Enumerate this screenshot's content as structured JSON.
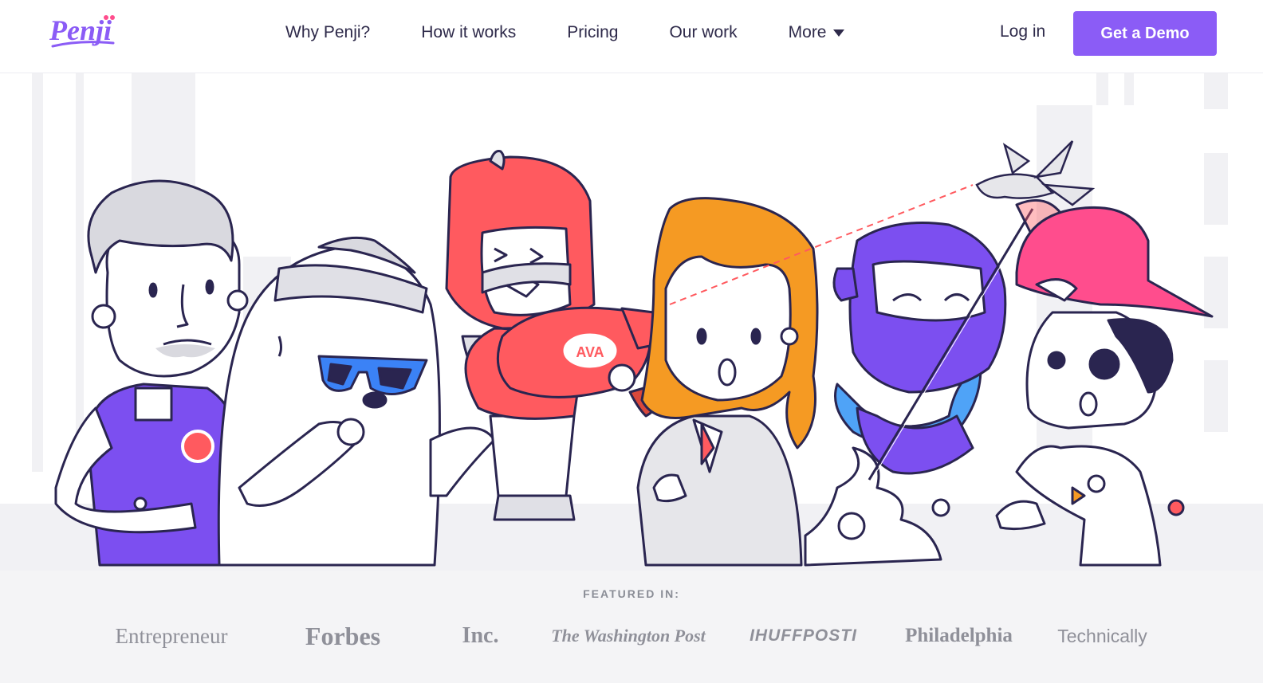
{
  "brand": {
    "name": "Penji",
    "color": "#8b5cf6"
  },
  "nav": {
    "items": [
      {
        "label": "Why Penji?"
      },
      {
        "label": "How it works"
      },
      {
        "label": "Pricing"
      },
      {
        "label": "Our work"
      },
      {
        "label": "More"
      }
    ],
    "more_icon": "caret-down-icon",
    "login_label": "Log in",
    "demo_label": "Get a Demo"
  },
  "hero": {
    "illustration": "cartoon-characters-group",
    "badge_text": "AVA"
  },
  "featured": {
    "title": "FEATURED IN:",
    "logos": [
      "Entrepreneur",
      "Forbes",
      "Inc.",
      "The Washington Post",
      "IHUFFPOSTI",
      "Philadelphia",
      "Technically"
    ]
  },
  "colors": {
    "accent": "#8b5cf6",
    "text": "#2e2a4a",
    "featured_bg": "#f4f4f6",
    "logo_gray": "#8f9099"
  }
}
